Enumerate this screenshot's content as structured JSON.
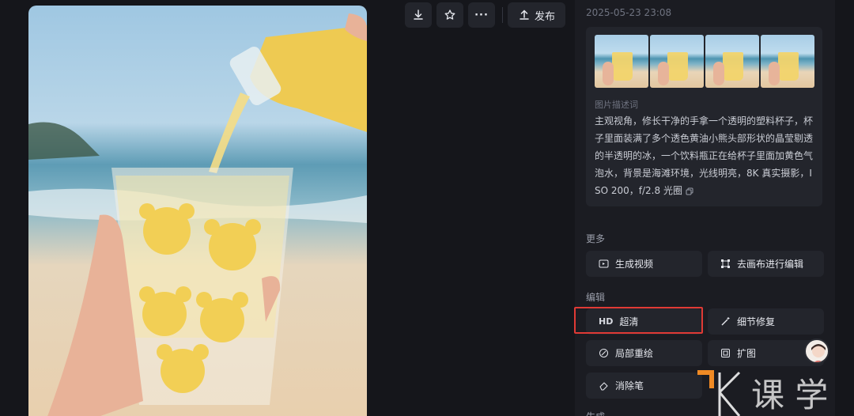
{
  "toolbar": {
    "download_icon": "download-icon",
    "favorite_icon": "star-icon",
    "more_label": "···",
    "publish_label": "发布"
  },
  "info": {
    "timestamp": "2025-05-23 23:08",
    "prompt_label": "图片描述词",
    "prompt_text": "主观视角，修长干净的手拿一个透明的塑料杯子，杯子里面装满了多个透色黄油小熊头部形状的晶莹剔透的半透明的冰，一个饮料瓶正在给杯子里面加黄色气泡水，背景是海滩环境，光线明亮，8K 真实摄影，ISO 200，f/2.8 光圈"
  },
  "more": {
    "title": "更多",
    "generate_video": "生成视频",
    "canvas_edit": "去画布进行编辑"
  },
  "edit": {
    "title": "编辑",
    "hd_tag": "HD",
    "upscale": "超清",
    "detail_repair": "细节修复",
    "inpaint": "局部重绘",
    "expand": "扩图",
    "eraser": "消除笔"
  },
  "next_section": {
    "title": "生成"
  },
  "watermark": {
    "text": "课 学"
  },
  "colors": {
    "background": "#15161b",
    "panel": "#1b1c22",
    "button": "#23252c",
    "highlight_border": "#e03a35",
    "watermark_orange": "#f08a24"
  }
}
